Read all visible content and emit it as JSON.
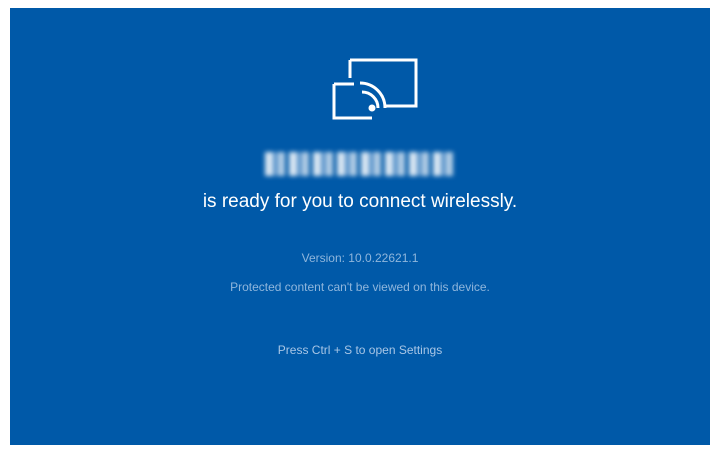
{
  "screen": {
    "background_color": "#0059A8",
    "icon": "wireless-display-cast-icon",
    "device_name": "Hujon-ThePing",
    "ready_message": "is ready for you to connect wirelessly.",
    "version_label": "Version: 10.0.22621.1",
    "protected_notice": "Protected content can't be viewed on this device.",
    "settings_hint": "Press Ctrl + S to open Settings"
  }
}
